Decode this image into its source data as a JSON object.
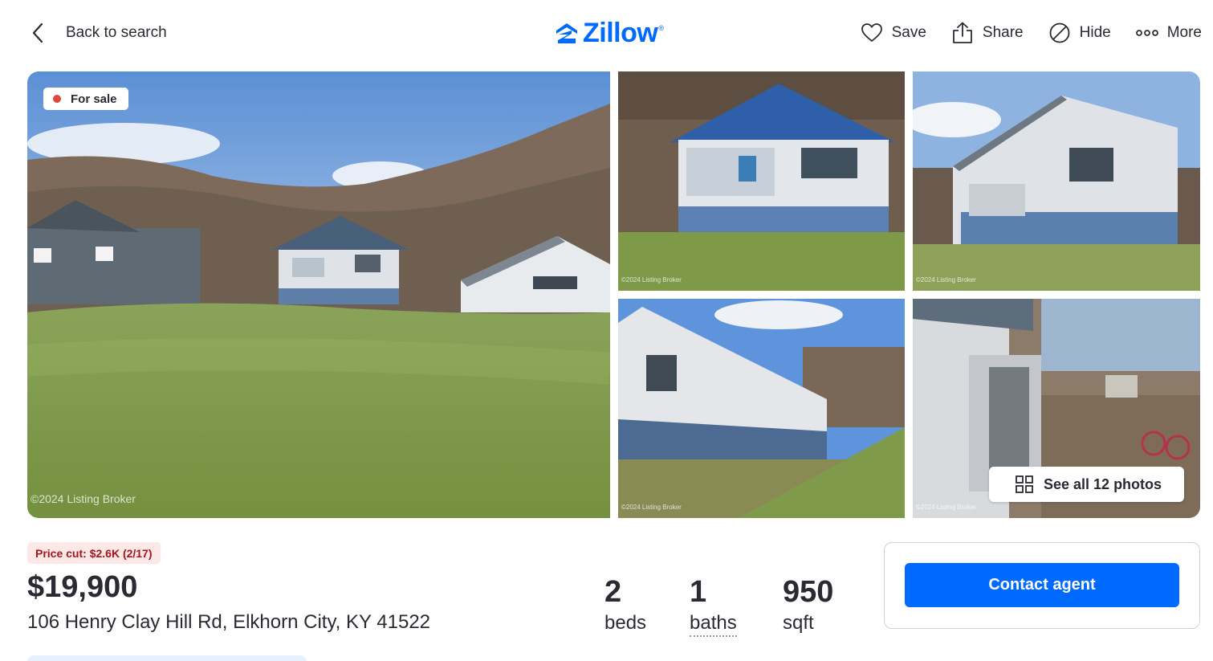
{
  "header": {
    "back_label": "Back to search",
    "logo_text": "Zillow",
    "logo_mark": "®",
    "actions": [
      {
        "label": "Save",
        "icon": "heart-icon"
      },
      {
        "label": "Share",
        "icon": "share-icon"
      },
      {
        "label": "Hide",
        "icon": "hide-icon"
      },
      {
        "label": "More",
        "icon": "more-icon"
      }
    ]
  },
  "gallery": {
    "status_badge": "For sale",
    "see_all_label": "See all 12 photos",
    "watermark": "©2024 Listing Broker",
    "watermark_small": "©2024 Listing Broker"
  },
  "summary": {
    "price_cut": "Price cut: $2.6K (2/17)",
    "price": "$19,900",
    "address": "106 Henry Clay Hill Rd, Elkhorn City, KY 41522",
    "beds_value": "2",
    "beds_label": "beds",
    "baths_value": "1",
    "baths_label": "baths",
    "sqft_value": "950",
    "sqft_label": "sqft"
  },
  "contact": {
    "button_label": "Contact agent"
  },
  "colors": {
    "brand_blue": "#006aff",
    "price_cut_bg": "#fde8e8",
    "price_cut_text": "#a4161a",
    "status_dot": "#e2463d"
  }
}
